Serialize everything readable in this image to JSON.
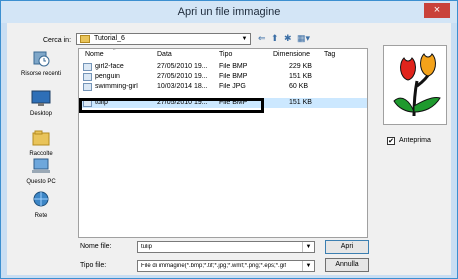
{
  "window": {
    "title": "Apri un file immagine",
    "close_symbol": "×"
  },
  "lookin": {
    "label": "Cerca in:",
    "value": "Tutorial_6"
  },
  "toolbar": {
    "back": "⇐",
    "up": "⬆",
    "newfolder": "✱",
    "views": "▦▾"
  },
  "places": [
    {
      "label": "Risorse recenti",
      "icon": "recent-icon"
    },
    {
      "label": "Desktop",
      "icon": "desktop-icon"
    },
    {
      "label": "Raccolte",
      "icon": "libraries-icon"
    },
    {
      "label": "Questo PC",
      "icon": "computer-icon"
    },
    {
      "label": "Rete",
      "icon": "network-icon"
    }
  ],
  "columns": [
    "Nome",
    "Data",
    "Tipo",
    "Dimensione",
    "Tag"
  ],
  "files": [
    {
      "name": "girl2-face",
      "date": "27/05/2010 19...",
      "type": "File BMP",
      "size": "229 KB",
      "selected": false
    },
    {
      "name": "penguin",
      "date": "27/05/2010 19...",
      "type": "File BMP",
      "size": "151 KB",
      "selected": false
    },
    {
      "name": "swimming-girl",
      "date": "10/03/2014 18...",
      "type": "File JPG",
      "size": "60 KB",
      "selected": false
    },
    {
      "name": "tulip",
      "date": "27/05/2010 19...",
      "type": "File BMP",
      "size": "151 KB",
      "selected": true
    }
  ],
  "preview": {
    "checkbox_label": "Anteprima",
    "checked": true,
    "check_mark": "✔"
  },
  "filename": {
    "label": "Nome file:",
    "value": "tulip"
  },
  "filetype": {
    "label": "Tipo file:",
    "value": "File di immagine(*.bmp;*.tif;*.jpg;*.wmf;*.png;*.eps;*.gif"
  },
  "buttons": {
    "open": "Apri",
    "cancel": "Annulla"
  },
  "colors": {
    "titlebar": "#d3e5f6",
    "close": "#c9423a",
    "selection": "#cce8ff"
  }
}
